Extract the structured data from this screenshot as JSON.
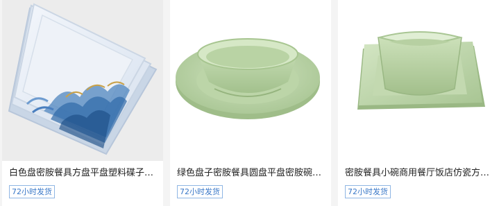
{
  "products": [
    {
      "title": "白色盘密胺餐具方盘平盘塑料碟子仿瓷圆形菜盘火锅店餐具",
      "shipping_badge": "72小时发货",
      "image": "white-square-plate-stack-wave-pattern"
    },
    {
      "title": "绿色盘子密胺餐具圆盘平盘密胺碗仿瓷塑料餐具套装",
      "shipping_badge": "72小时发货",
      "image": "green-round-bowl-and-plate"
    },
    {
      "title": "密胺餐具小碗商用餐厅饭店仿瓷方碗塑料碗汤碗",
      "shipping_badge": "72小时发货",
      "image": "green-square-bowl-on-plate"
    }
  ],
  "colors": {
    "badge_border": "#8fb6e4",
    "badge_text": "#3a78c8",
    "title_text": "#222222",
    "melamine_green": "#b9d3a6"
  }
}
